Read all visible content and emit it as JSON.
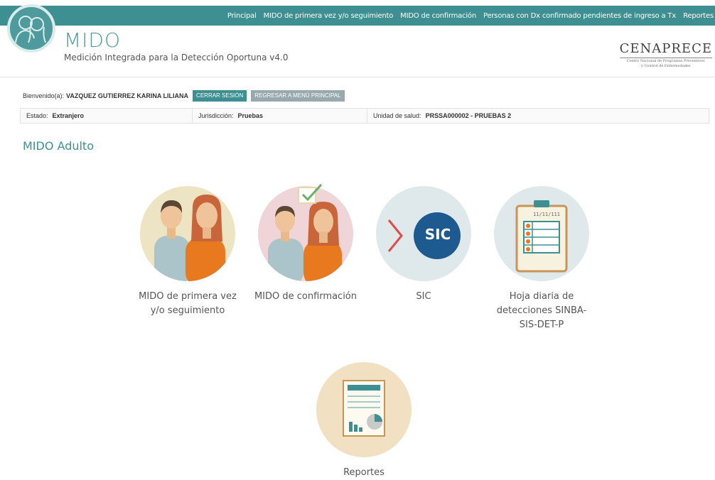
{
  "nav": {
    "items": [
      "Principal",
      "MIDO de primera vez y/o seguimiento",
      "MIDO de confirmación",
      "Personas con Dx confirmado pendientes de ingreso a Tx",
      "Reportes"
    ]
  },
  "header": {
    "title": "MIDO",
    "subtitle": "Medición Integrada para la Detección Oportuna v4.0",
    "org_name": "CENAPRECE",
    "org_sub1": "Centro Nacional de Programas Preventivos",
    "org_sub2": "y Control de Enfermedades"
  },
  "user": {
    "welcome_label": "Bienvenido(a):",
    "name": "VAZQUEZ GUTIERREZ KARINA LILIANA",
    "logout_label": "CERRAR SESIÓN",
    "back_label": "REGRESAR A MENÚ PRINCIPAL"
  },
  "info": {
    "estado_label": "Estado:",
    "estado_value": "Extranjero",
    "jurisdiccion_label": "Jurisdicción:",
    "jurisdiccion_value": "Pruebas",
    "unidad_label": "Unidad de salud:",
    "unidad_value": "PRSSA000002 - PRUEBAS 2"
  },
  "section": {
    "title": "MIDO Adulto"
  },
  "tiles": {
    "primera": {
      "line1": "MIDO de primera vez",
      "line2": "y/o seguimiento"
    },
    "confirmacion": {
      "line1": "MIDO de confirmación"
    },
    "sic": {
      "line1": "SIC",
      "logo_text": "SIC"
    },
    "hoja": {
      "line1": "Hoja diaria de",
      "line2": "detecciones SINBA-",
      "line3": "SIS-DET-P",
      "clipboard_text": "11/11/111"
    },
    "reportes": {
      "line1": "Reportes"
    }
  },
  "colors": {
    "brand": "#3e8f91",
    "button_gray": "#98a9ad",
    "orange": "#e07a1f",
    "sic_blue": "#1c5a8f"
  }
}
